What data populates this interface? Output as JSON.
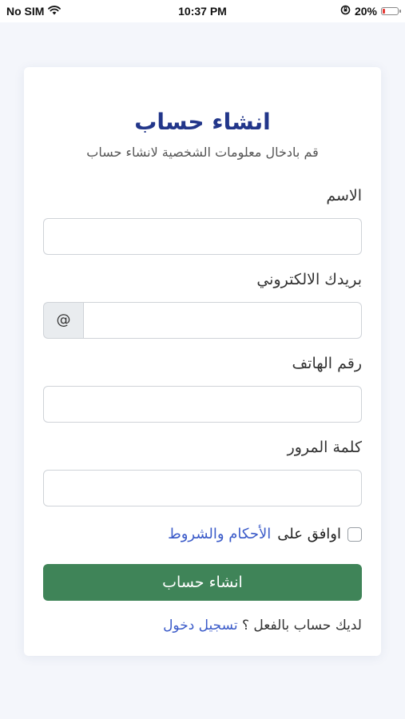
{
  "status_bar": {
    "carrier": "No SIM",
    "time": "10:37 PM",
    "battery": "20%",
    "battery_level": 0.2,
    "icons": [
      "wifi-icon",
      "orientation-lock-icon",
      "battery-icon"
    ]
  },
  "form": {
    "title": "انشاء حساب",
    "subtitle": "قم بادخال معلومات الشخصية لانشاء حساب",
    "fields": {
      "name": {
        "label": "الاسم",
        "value": ""
      },
      "email": {
        "label": "بريدك الالكتروني",
        "addon": "@",
        "value": ""
      },
      "phone": {
        "label": "رقم الهاتف",
        "value": ""
      },
      "password": {
        "label": "كلمة المرور",
        "value": ""
      }
    },
    "terms": {
      "prefix": "اوافق على",
      "link": "الأحكام والشروط",
      "checked": false
    },
    "submit_label": "انشاء حساب",
    "footer": {
      "prefix": "لديك حساب بالفعل ؟",
      "link": "تسجيل دخول"
    }
  },
  "colors": {
    "title": "#22368a",
    "link": "#3b5bc9",
    "submit_bg": "#3f8458",
    "page_bg": "#f4f6fb"
  }
}
